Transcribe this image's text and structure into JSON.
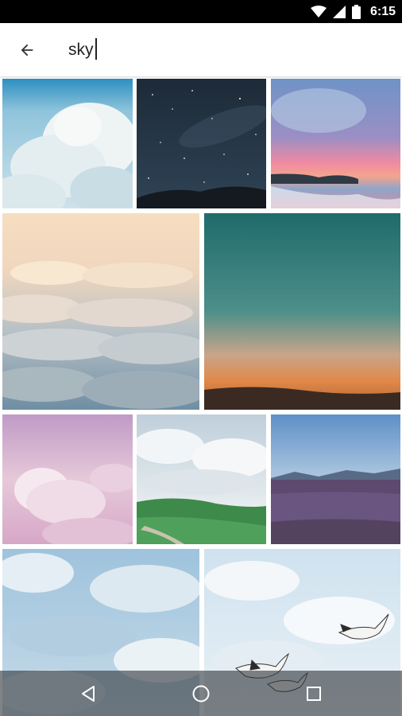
{
  "status_bar": {
    "time": "6:15",
    "icons": [
      "wifi-icon",
      "cell-signal-icon",
      "battery-icon"
    ]
  },
  "search": {
    "query": "sky",
    "back_icon": "arrow-back-icon"
  },
  "results": [
    {
      "name": "puffy-clouds-blue-sky"
    },
    {
      "name": "starry-night-sky"
    },
    {
      "name": "pink-sunset-beach"
    },
    {
      "name": "cloud-sea-aerial"
    },
    {
      "name": "teal-orange-dusk"
    },
    {
      "name": "pink-clouds"
    },
    {
      "name": "green-hills-cloudy-sky"
    },
    {
      "name": "lavender-field-mountains"
    },
    {
      "name": "soft-blue-clouds"
    },
    {
      "name": "pelicans-in-sky"
    }
  ],
  "nav_bar": {
    "icons": [
      "back-triangle-icon",
      "home-circle-icon",
      "recents-square-icon"
    ]
  }
}
